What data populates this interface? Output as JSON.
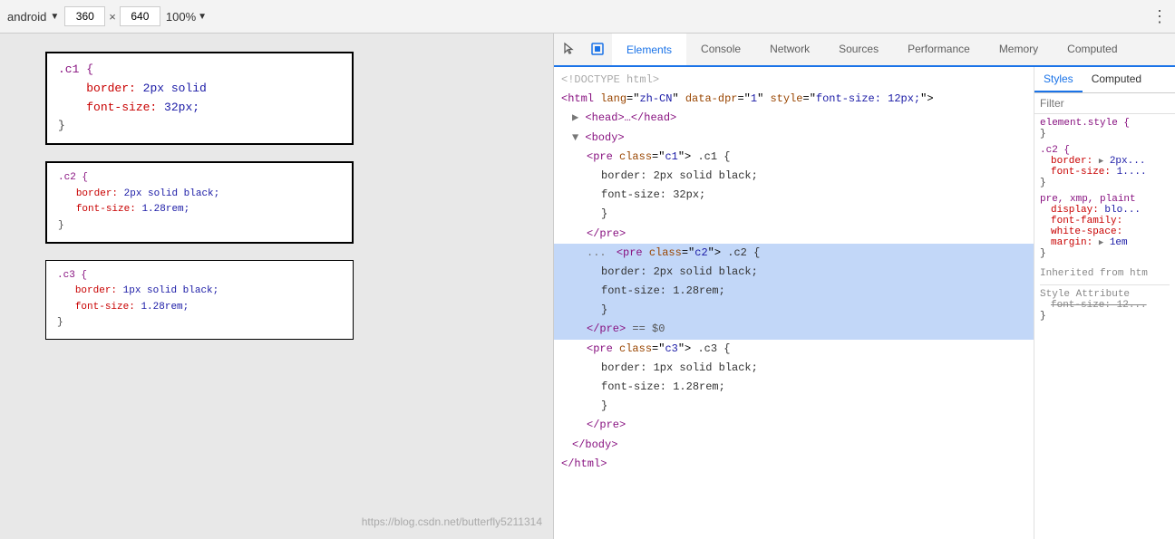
{
  "toolbar": {
    "device": "android",
    "width": "360",
    "height": "640",
    "zoom": "100%",
    "dots_icon": "⋮"
  },
  "tabs": {
    "items": [
      {
        "label": "Elements",
        "active": true
      },
      {
        "label": "Console",
        "active": false
      },
      {
        "label": "Network",
        "active": false
      },
      {
        "label": "Sources",
        "active": false
      },
      {
        "label": "Performance",
        "active": false
      },
      {
        "label": "Memory",
        "active": false
      },
      {
        "label": "Computed",
        "active": false
      }
    ]
  },
  "styles_tabs": [
    {
      "label": "Styles",
      "active": true
    },
    {
      "label": "Computed",
      "active": false
    }
  ],
  "styles_filter": {
    "placeholder": "Filter"
  },
  "preview": {
    "boxes": [
      {
        "id": "c1",
        "lines": [
          ".c1 {",
          "    border: 2px solid",
          "    font-size: 32px;",
          "}"
        ]
      },
      {
        "id": "c2",
        "lines": [
          ".c2 {",
          "   border: 2px solid black;",
          "   font-size: 1.28rem;",
          "}"
        ]
      },
      {
        "id": "c3",
        "lines": [
          ".c3 {",
          "   border: 1px solid black;",
          "   font-size: 1.28rem;",
          "}"
        ]
      }
    ],
    "url": "https://blog.csdn.net/butterfly5211314"
  },
  "html_tree": {
    "lines": [
      {
        "indent": 0,
        "content": "<!DOCTYPE html>",
        "type": "comment"
      },
      {
        "indent": 0,
        "content": "<html lang=\"zh-CN\" data-dpr=\"1\" style=\"font-size: 12px;\">",
        "type": "tag"
      },
      {
        "indent": 1,
        "arrow": "▶",
        "content": "<head>…</head>",
        "type": "tag"
      },
      {
        "indent": 1,
        "arrow": "▼",
        "content": "<body>",
        "type": "tag"
      },
      {
        "indent": 2,
        "content": "<pre class=\"c1\"> .c1 {",
        "type": "tag"
      },
      {
        "indent": 3,
        "content": "border: 2px solid black;",
        "type": "text"
      },
      {
        "indent": 3,
        "content": "font-size: 32px;",
        "type": "text"
      },
      {
        "indent": 3,
        "content": "}",
        "type": "text"
      },
      {
        "indent": 2,
        "content": "</pre>",
        "type": "tag"
      },
      {
        "indent": 2,
        "selected": true,
        "dots": "...",
        "content": "<pre class=\"c2\"> .c2 {",
        "type": "tag"
      },
      {
        "indent": 3,
        "content": "border: 2px solid black;",
        "type": "text"
      },
      {
        "indent": 3,
        "content": "font-size: 1.28rem;",
        "type": "text"
      },
      {
        "indent": 3,
        "content": "}",
        "type": "text"
      },
      {
        "indent": 2,
        "selected": true,
        "content": "</pre> == $0",
        "type": "tag_eq"
      },
      {
        "indent": 2,
        "content": "<pre class=\"c3\"> .c3 {",
        "type": "tag"
      },
      {
        "indent": 3,
        "content": "border: 1px solid black;",
        "type": "text"
      },
      {
        "indent": 3,
        "content": "font-size: 1.28rem;",
        "type": "text"
      },
      {
        "indent": 3,
        "content": "}",
        "type": "text"
      },
      {
        "indent": 2,
        "content": "</pre>",
        "type": "tag"
      },
      {
        "indent": 1,
        "content": "</body>",
        "type": "tag"
      },
      {
        "indent": 0,
        "content": "</html>",
        "type": "tag"
      }
    ]
  },
  "styles": {
    "element_style": {
      "selector": "element.style {",
      "close": "}"
    },
    "rule_c2": {
      "selector": ".c2 {",
      "props": [
        {
          "name": "border:",
          "value": "▶ 2px...",
          "arrow": true
        },
        {
          "name": "font-size:",
          "value": "1...."
        }
      ],
      "close": "}"
    },
    "rule_pre": {
      "selector": "pre, xmp, plaint",
      "props": [
        {
          "name": "display:",
          "value": "blo..."
        },
        {
          "name": "font-family:",
          "value": ""
        },
        {
          "name": "white-space:",
          "value": ""
        },
        {
          "name": "margin:",
          "value": "▶ 1em",
          "arrow": true
        }
      ],
      "close": "}"
    },
    "inherited": "Inherited from  htm",
    "style_attribute": "Style Attribute",
    "style_attr_prop": {
      "name": "font-size:",
      "value": "12...",
      "strikethrough": true
    }
  }
}
